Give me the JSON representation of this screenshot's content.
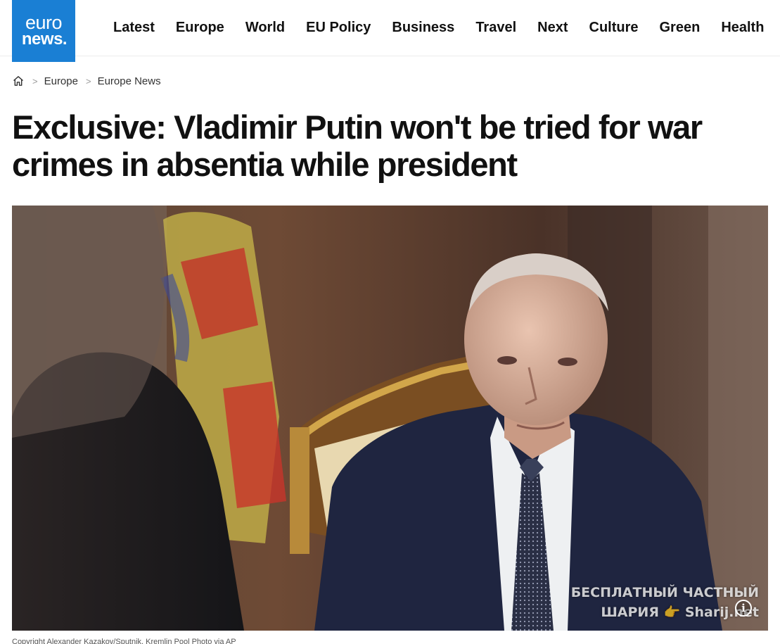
{
  "header": {
    "logo_line1": "euro",
    "logo_line2": "news.",
    "brand_color": "#1a7fd4",
    "nav": [
      "Latest",
      "Europe",
      "World",
      "EU Policy",
      "Business",
      "Travel",
      "Next",
      "Culture",
      "Green",
      "Health"
    ]
  },
  "breadcrumb": {
    "home_icon": "home-icon",
    "items": [
      "Europe",
      "Europe News"
    ]
  },
  "article": {
    "title": "Exclusive: Vladimir Putin won't be tried for war crimes in absentia while president",
    "caption": "Copyright Alexander Kazakov/Sputnik, Kremlin Pool Photo via AP"
  },
  "photo": {
    "watermark_line1": "БЕСПЛАТНЫЙ ЧАСТНЫЙ",
    "watermark_line2": "ШАРИЯ 👉 Sharij.net",
    "info_label": "i"
  }
}
